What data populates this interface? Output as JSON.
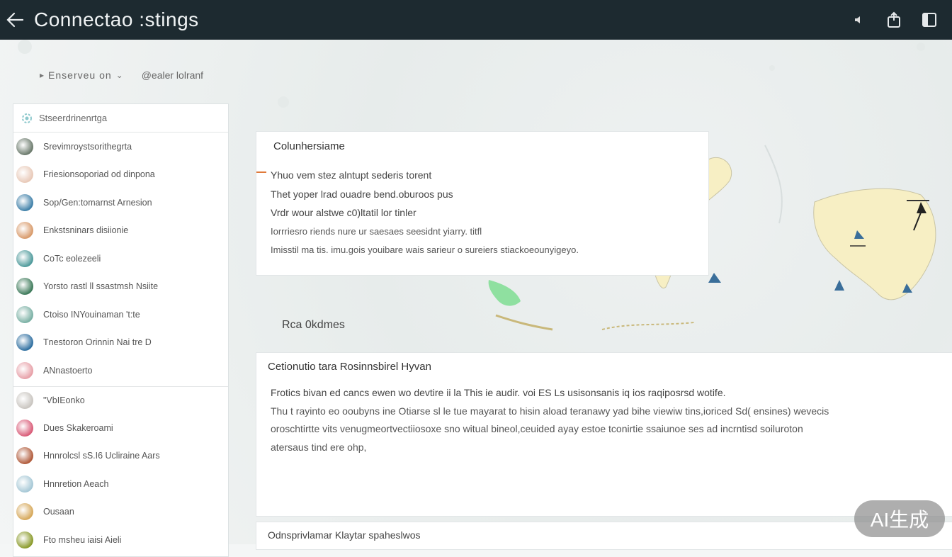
{
  "header": {
    "title": "Connectao :stings"
  },
  "filters": {
    "left_label": "Enserveu on",
    "right_label": "@ealer lolranf"
  },
  "sidebar": {
    "search_placeholder": "Stseerdrinenrtga",
    "items": [
      {
        "label": "Srevimroystsorithegrta",
        "color": "#6b7a6c"
      },
      {
        "label": "Friesionsoporiad od dinpona",
        "color": "#e8c9b8"
      },
      {
        "label": "Sop/Gen:tomarnst Arnesion",
        "color": "#3e7fa8"
      },
      {
        "label": "Enkstsninars disiionie",
        "color": "#d89a6a"
      },
      {
        "label": "CoTc eolezeeli",
        "color": "#4e9a9b"
      },
      {
        "label": "Yorsto rastl ll ssastmsh Nsiite",
        "color": "#3d7a5a"
      },
      {
        "label": "Ctoiso INYouinaman 't:te",
        "color": "#7ab0a4"
      },
      {
        "label": "Tnestoron Orinnin Nai tre D",
        "color": "#2f6fa0"
      },
      {
        "label": "ANnastoerto",
        "color": "#e7a0a8"
      },
      {
        "label": "\"VbIEonko",
        "color": "#c9c5c0"
      },
      {
        "label": "Dues Skakeroami",
        "color": "#d95c78"
      },
      {
        "label": "Hnnrolcsl sS.I6 Ucliraine Aars",
        "color": "#b05a3a"
      },
      {
        "label": "Hnnretion Aeach",
        "color": "#a6c8d6"
      },
      {
        "label": "Ousaan",
        "color": "#d6a85a"
      },
      {
        "label": "Fto msheu iaisi Aieli",
        "color": "#8a9a2a"
      }
    ]
  },
  "card1": {
    "heading": "Colunhersiame",
    "lines": [
      "Yhuo vem stez alntupt sederis torent",
      "Thet yoper lrad ouadre bend.oburoos pus",
      "Vrdr wour alstwe c0)ltatil lor tinler",
      "Iorrriesro riends nure ur saesaes seesidnt yiarry. titfl",
      "Imisstil ma tis. imu.gois youibare wais sarieur o sureiers stiackoeounyigeyo."
    ]
  },
  "section": {
    "label": "Rca 0kdmes"
  },
  "card2": {
    "heading": "Cetionutio tara Rosinnsbirel Hyvan",
    "lines": [
      "Frotics bivan ed cancs ewen wo devtire ii la This ie audir. voi ES Ls usisonsanis iq ios raqiposrsd wotife.",
      "Thu t rayinto eo ooubyns ine Otiarse sl le tue mayarat to hisin aload teranawy yad bihe viewiw tins,ioriced Sd( ensines) wevecis",
      "oroschtirtte vits venugmeortvectiiosoxe sno witual bineol,ceuided ayay estoe tconirtie ssaiunoe ses ad incrntisd soiluroton",
      "atersaus tind ere ohp,"
    ]
  },
  "card3": {
    "heading": "Odnsprivlamar Klaytar spaheslwos"
  },
  "watermark": {
    "text": "AI生成"
  },
  "colors": {
    "topbar": "#1d2a30",
    "accent": "#e07a3a",
    "map_land": "#f7efc4",
    "map_green": "#8fe0a0"
  }
}
